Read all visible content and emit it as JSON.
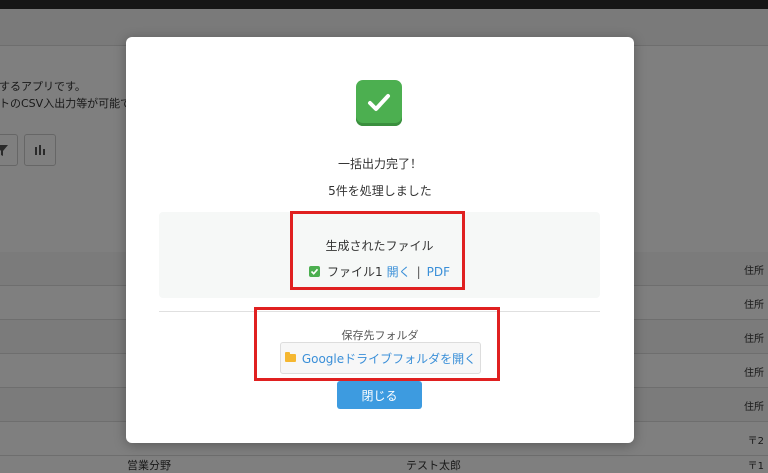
{
  "background": {
    "description_lines": [
      "録するアプリです。",
      "ストのCSV入出力等が可能で"
    ],
    "tool_icons": [
      "filter-icon",
      "bar-chart-icon"
    ],
    "row_cells_right": [
      "住所",
      "住所",
      "住所",
      "住所",
      "住所",
      "〒2"
    ],
    "bottom_row": {
      "department": "営業分野",
      "name": "テスト太郎",
      "right": "〒1"
    }
  },
  "modal": {
    "icon": "check-icon",
    "title": "一括出力完了！",
    "subtitle": "5件を処理しました",
    "files": {
      "label": "生成されたファイル",
      "file_name": "ファイル1",
      "open_link": "開く",
      "separator": "|",
      "pdf_link": "PDF"
    },
    "folder": {
      "label": "保存先フォルダ",
      "button_label": "Googleドライブフォルダを開く"
    },
    "close_label": "閉じる"
  },
  "colors": {
    "accent": "#3d9be0",
    "success": "#4caf50",
    "highlight": "#e02020",
    "link": "#3a8fd8"
  }
}
